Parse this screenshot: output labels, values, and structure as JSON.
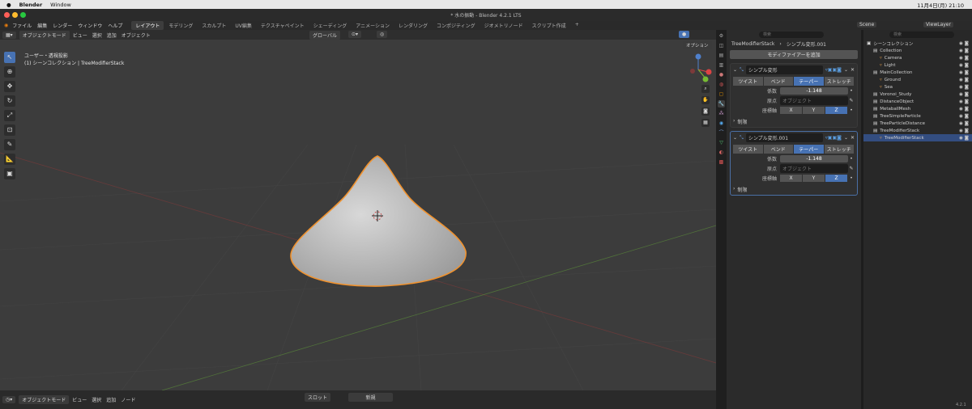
{
  "mac_menu": {
    "app": "Blender",
    "window": "Window",
    "clock": "11月4日(月) 21:10"
  },
  "window_title": "* 水の振動 - Blender 4.2.1 LTS",
  "menus": [
    "ファイル",
    "編集",
    "レンダー",
    "ウィンドウ",
    "ヘルプ"
  ],
  "workspaces": [
    "レイアウト",
    "モデリング",
    "スカルプト",
    "UV編集",
    "テクスチャペイント",
    "シェーディング",
    "アニメーション",
    "レンダリング",
    "コンポジティング",
    "ジオメトリノード",
    "スクリプト作成",
    "+"
  ],
  "scene": {
    "name": "Scene",
    "view_layer": "ViewLayer"
  },
  "viewport_header": {
    "mode": "オブジェクトモード",
    "menus": [
      "ビュー",
      "選択",
      "追加",
      "オブジェクト"
    ],
    "orientation": "グローバル",
    "options": "オプション"
  },
  "viewport_info": {
    "line1": "ユーザー・透視投影",
    "line2": "(1) シーンコレクション | TreeModifierStack"
  },
  "gizmo": {
    "x": "X",
    "y": "Y",
    "z": "Z"
  },
  "properties": {
    "object_name": "TreeModifierStack",
    "modifier_path": "シンプル変形.001",
    "search_placeholder": "検索",
    "add_modifier": "モディファイアーを追加",
    "modifiers": [
      {
        "name": "シンプル変形",
        "modes": [
          "ツイスト",
          "ベンド",
          "テーパー",
          "ストレッチ"
        ],
        "active_mode": 2,
        "factor_label": "係数",
        "factor_value": "-1.148",
        "origin_label": "原点",
        "origin_placeholder": "オブジェクト",
        "axis_label": "座標軸",
        "axes": [
          "X",
          "Y",
          "Z"
        ],
        "active_axis": 2,
        "limits": "制限"
      },
      {
        "name": "シンプル変形.001",
        "modes": [
          "ツイスト",
          "ベンド",
          "テーパー",
          "ストレッチ"
        ],
        "active_mode": 2,
        "factor_label": "係数",
        "factor_value": "-1.148",
        "origin_label": "原点",
        "origin_placeholder": "オブジェクト",
        "axis_label": "座標軸",
        "axes": [
          "X",
          "Y",
          "Z"
        ],
        "active_axis": 2,
        "limits": "制限"
      }
    ]
  },
  "outliner": {
    "search_placeholder": "検索",
    "rows": [
      {
        "label": "シーンコレクション",
        "indent": 0,
        "hl": false
      },
      {
        "label": "Collection",
        "indent": 1,
        "hl": false
      },
      {
        "label": "Camera",
        "indent": 2,
        "hl": false
      },
      {
        "label": "Light",
        "indent": 2,
        "hl": false
      },
      {
        "label": "MainCollection",
        "indent": 1,
        "hl": false
      },
      {
        "label": "Ground",
        "indent": 2,
        "hl": false
      },
      {
        "label": "Sea",
        "indent": 2,
        "hl": false
      },
      {
        "label": "Voronoi_Study",
        "indent": 1,
        "hl": false
      },
      {
        "label": "DistanceObject",
        "indent": 1,
        "hl": false
      },
      {
        "label": "MetaballMesh",
        "indent": 1,
        "hl": false
      },
      {
        "label": "TreeSimpleParticle",
        "indent": 1,
        "hl": false
      },
      {
        "label": "TreeParticleDistance",
        "indent": 1,
        "hl": false
      },
      {
        "label": "TreeModifierStack",
        "indent": 1,
        "hl": false
      },
      {
        "label": "TreeModifierStack",
        "indent": 2,
        "hl": true
      }
    ]
  },
  "timeline": {
    "mode": "オブジェクトモード",
    "menus": [
      "ビュー",
      "選択",
      "追加",
      "ノード"
    ],
    "slot": "スロット",
    "new": "新規"
  },
  "status": {
    "version": "4.2.1"
  }
}
